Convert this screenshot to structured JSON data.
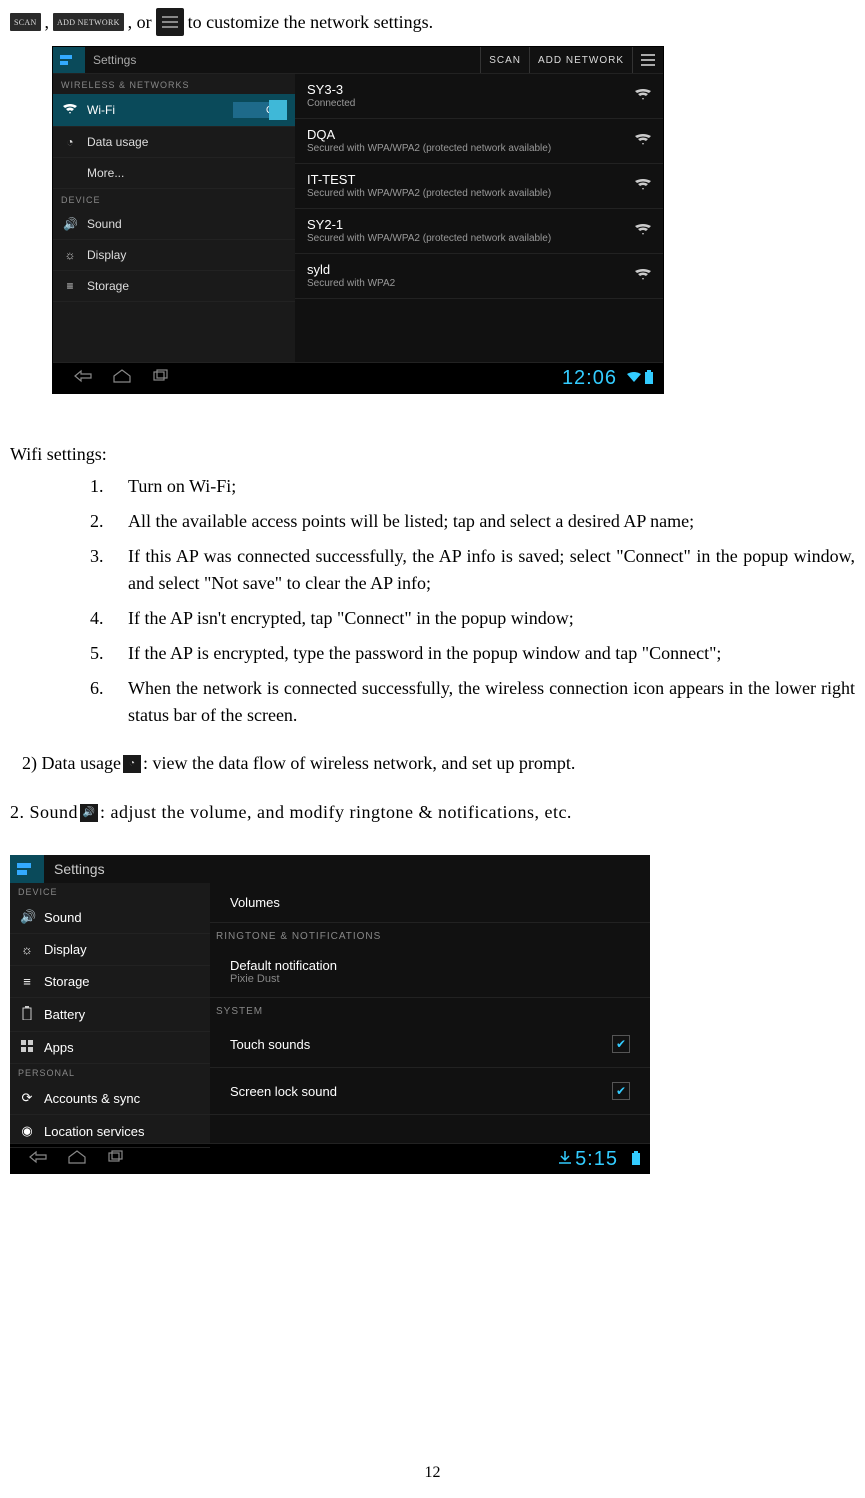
{
  "intro": {
    "btn_scan": "SCAN",
    "btn_add": "ADD NETWORK",
    "text_or": ", or",
    "text_rest": "to customize the network settings.",
    "comma1": ","
  },
  "screenshot1": {
    "title": "Settings",
    "scan": "SCAN",
    "add_network": "ADD NETWORK",
    "left_hdr_wireless": "WIRELESS & NETWORKS",
    "wifi_label": "Wi-Fi",
    "wifi_on": "ON",
    "data_usage": "Data usage",
    "more": "More...",
    "left_hdr_device": "DEVICE",
    "sound": "Sound",
    "display": "Display",
    "storage": "Storage",
    "networks": [
      {
        "ssid": "SY3-3",
        "desc": "Connected"
      },
      {
        "ssid": "DQA",
        "desc": "Secured with WPA/WPA2 (protected network available)"
      },
      {
        "ssid": "IT-TEST",
        "desc": "Secured with WPA/WPA2 (protected network available)"
      },
      {
        "ssid": "SY2-1",
        "desc": "Secured with WPA/WPA2 (protected network available)"
      },
      {
        "ssid": "syld",
        "desc": "Secured with WPA2"
      }
    ],
    "clock": "12:06"
  },
  "body": {
    "heading": "Wifi settings:",
    "items": [
      "Turn on Wi-Fi;",
      "All the available access points will be listed; tap and select a desired AP name;",
      "If this AP was connected successfully, the AP info is saved; select \"Connect\" in the popup window, and select \"Not save\" to clear the AP info;",
      "If the AP isn't encrypted, tap \"Connect\" in the popup window;",
      "If the AP is encrypted, type the password in the popup window and tap \"Connect\";",
      "When the network is connected successfully, the wireless connection icon appears in the lower right status bar of the screen."
    ],
    "data_usage_prefix": "2) Data usage",
    "data_usage_rest": ": view the data flow of wireless network, and set up prompt.",
    "sound_prefix": "2.  Sound",
    "sound_rest": ":  adjust  the  volume,  and  modify  ringtone  &  notifications,  etc."
  },
  "screenshot2": {
    "title": "Settings",
    "left_hdr_device": "DEVICE",
    "sound": "Sound",
    "display": "Display",
    "storage": "Storage",
    "battery": "Battery",
    "apps": "Apps",
    "left_hdr_personal": "PERSONAL",
    "accounts_sync": "Accounts & sync",
    "location_services": "Location services",
    "volumes": "Volumes",
    "ringtone_hdr": "RINGTONE & NOTIFICATIONS",
    "default_notif": "Default notification",
    "pixie_dust": "Pixie Dust",
    "system_hdr": "SYSTEM",
    "touch_sounds": "Touch sounds",
    "screen_lock_sound": "Screen lock sound",
    "clock": "5:15"
  },
  "page_number": "12"
}
